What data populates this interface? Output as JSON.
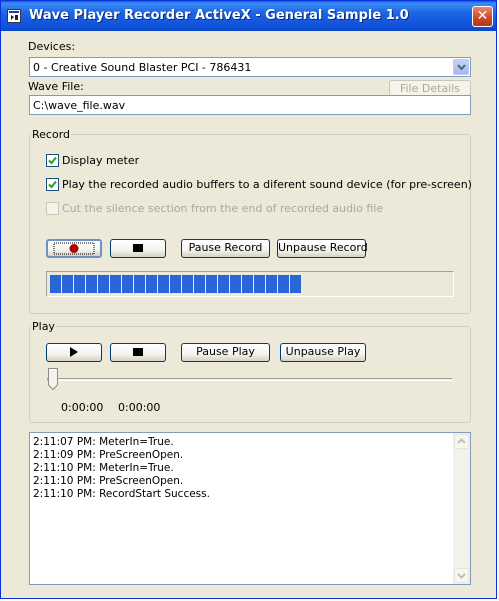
{
  "window": {
    "title": "Wave Player Recorder ActiveX - General Sample 1.0",
    "close_glyph": "✕"
  },
  "devices": {
    "label": "Devices:",
    "selected": "0 - Creative Sound Blaster PCI - 786431"
  },
  "wave_file": {
    "label": "Wave File:",
    "value": "C:\\wave_file.wav",
    "file_details_label": "File Details",
    "file_details_enabled": false
  },
  "record": {
    "title": "Record",
    "display_meter_label": "Display meter",
    "display_meter_checked": true,
    "prescreen_label": "Play the recorded audio buffers to a diferent sound device (for pre-screen)",
    "prescreen_checked": true,
    "cut_silence_label": "Cut the silence section from the end of recorded audio file",
    "cut_silence_checked": false,
    "cut_silence_enabled": false,
    "record_button_icon": "record-icon",
    "stop_button_icon": "stop-icon",
    "pause_label": "Pause Record",
    "unpause_label": "Unpause Record",
    "meter_level_cells": 21,
    "meter_total_cells": 34
  },
  "play": {
    "title": "Play",
    "play_button_icon": "play-icon",
    "stop_button_icon": "stop-icon",
    "pause_label": "Pause Play",
    "unpause_label": "Unpause Play",
    "position_fraction": 0.0,
    "current_time": "0:00:00",
    "total_time": "0:00:00"
  },
  "log": {
    "lines": [
      "2:11:07 PM: MeterIn=True.",
      "2:11:09 PM: PreScreenOpen.",
      "2:11:10 PM: MeterIn=True.",
      "2:11:10 PM: PreScreenOpen.",
      "2:11:10 PM: RecordStart Success."
    ]
  },
  "colors": {
    "titlebar": "#0c55d9",
    "meter_fill": "#2b66d8",
    "window_bg": "#ece9d8"
  }
}
